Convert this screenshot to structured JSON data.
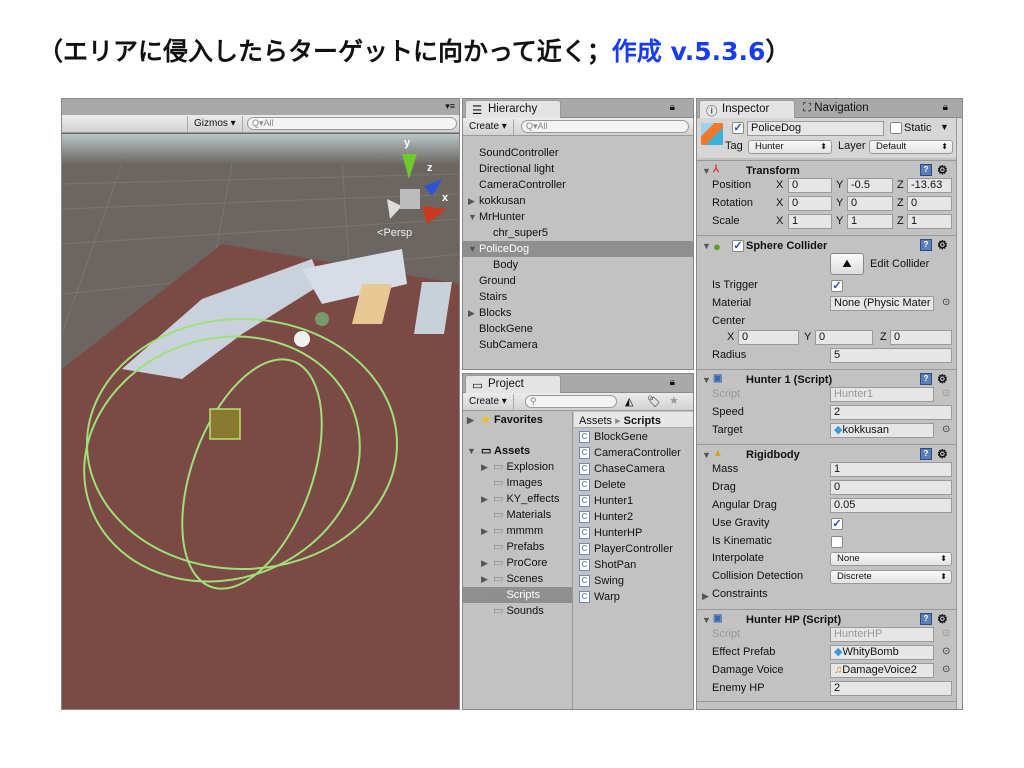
{
  "slide_title": {
    "main": "（エリアに侵入したらターゲットに向かって近く；",
    "accent": "作成 v.5.3.6",
    "close": "）",
    "accent_color": "#1a3cf0"
  },
  "scene": {
    "gizmos_label": "Gizmos",
    "search_placeholder": "All",
    "persp_label": "Persp",
    "axis_labels": {
      "x": "x",
      "y": "y",
      "z": "z"
    }
  },
  "hierarchy": {
    "tab": "Hierarchy",
    "create_label": "Create",
    "search_placeholder": "All",
    "items": [
      {
        "label": "SoundController",
        "indent": 0,
        "arrow": ""
      },
      {
        "label": "Directional light",
        "indent": 0,
        "arrow": ""
      },
      {
        "label": "CameraController",
        "indent": 0,
        "arrow": ""
      },
      {
        "label": "kokkusan",
        "indent": 0,
        "arrow": "▶"
      },
      {
        "label": "MrHunter",
        "indent": 0,
        "arrow": "▼"
      },
      {
        "label": "chr_super5",
        "indent": 1,
        "arrow": ""
      },
      {
        "label": "PoliceDog",
        "indent": 0,
        "arrow": "▼",
        "selected": true
      },
      {
        "label": "Body",
        "indent": 1,
        "arrow": ""
      },
      {
        "label": "Ground",
        "indent": 0,
        "arrow": ""
      },
      {
        "label": "Stairs",
        "indent": 0,
        "arrow": ""
      },
      {
        "label": "Blocks",
        "indent": 0,
        "arrow": "▶"
      },
      {
        "label": "BlockGene",
        "indent": 0,
        "arrow": ""
      },
      {
        "label": "SubCamera",
        "indent": 0,
        "arrow": ""
      }
    ]
  },
  "project": {
    "tab": "Project",
    "create_label": "Create",
    "favorites": "Favorites",
    "assets": "Assets",
    "folders": [
      {
        "label": "Explosion",
        "arrow": "▶"
      },
      {
        "label": "Images",
        "arrow": ""
      },
      {
        "label": "KY_effects",
        "arrow": "▶"
      },
      {
        "label": "Materials",
        "arrow": ""
      },
      {
        "label": "mmmm",
        "arrow": "▶"
      },
      {
        "label": "Prefabs",
        "arrow": ""
      },
      {
        "label": "ProCore",
        "arrow": "▶"
      },
      {
        "label": "Scenes",
        "arrow": "▶"
      },
      {
        "label": "Scripts",
        "arrow": "",
        "selected": true
      },
      {
        "label": "Sounds",
        "arrow": ""
      }
    ],
    "breadcrumb": {
      "root": "Assets",
      "current": "Scripts"
    },
    "scripts": [
      "BlockGene",
      "CameraController",
      "ChaseCamera",
      "Delete",
      "Hunter1",
      "Hunter2",
      "HunterHP",
      "PlayerController",
      "ShotPan",
      "Swing",
      "Warp"
    ]
  },
  "inspector": {
    "tab": "Inspector",
    "nav_tab": "Navigation",
    "object_name": "PoliceDog",
    "static_label": "Static",
    "tag_label": "Tag",
    "tag_value": "Hunter",
    "layer_label": "Layer",
    "layer_value": "Default",
    "transform": {
      "title": "Transform",
      "rows": [
        {
          "label": "Position",
          "x": "0",
          "y": "-0.5",
          "z": "-13.63"
        },
        {
          "label": "Rotation",
          "x": "0",
          "y": "0",
          "z": "0"
        },
        {
          "label": "Scale",
          "x": "1",
          "y": "1",
          "z": "1"
        }
      ]
    },
    "sphere_collider": {
      "title": "Sphere Collider",
      "edit_label": "Edit Collider",
      "is_trigger_label": "Is Trigger",
      "is_trigger": true,
      "material_label": "Material",
      "material": "None (Physic Mater",
      "center_label": "Center",
      "center": {
        "x": "0",
        "y": "0",
        "z": "0"
      },
      "radius_label": "Radius",
      "radius": "5"
    },
    "hunter1": {
      "title": "Hunter 1 (Script)",
      "script_label": "Script",
      "script": "Hunter1",
      "speed_label": "Speed",
      "speed": "2",
      "target_label": "Target",
      "target": "kokkusan"
    },
    "rigidbody": {
      "title": "Rigidbody",
      "mass_label": "Mass",
      "mass": "1",
      "drag_label": "Drag",
      "drag": "0",
      "angular_label": "Angular Drag",
      "angular": "0.05",
      "gravity_label": "Use Gravity",
      "gravity": true,
      "kinematic_label": "Is Kinematic",
      "kinematic": false,
      "interpolate_label": "Interpolate",
      "interpolate": "None",
      "collision_label": "Collision Detection",
      "collision": "Discrete",
      "constraints_label": "Constraints"
    },
    "hunterhp": {
      "title": "Hunter HP (Script)",
      "script_label": "Script",
      "script": "HunterHP",
      "effect_label": "Effect Prefab",
      "effect": "WhityBomb",
      "voice_label": "Damage Voice",
      "voice": "DamageVoice2",
      "hp_label": "Enemy HP",
      "hp": "2"
    }
  }
}
